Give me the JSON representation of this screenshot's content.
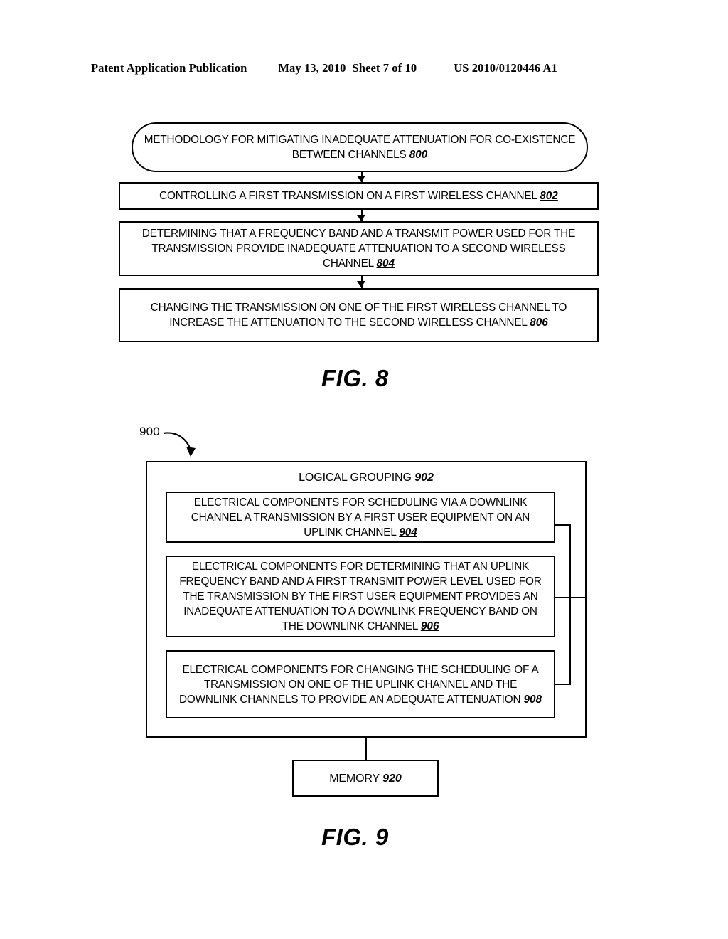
{
  "header": {
    "publication": "Patent Application Publication",
    "date": "May 13, 2010",
    "sheet": "Sheet 7 of 10",
    "doc_number": "US 2010/0120446 A1"
  },
  "figure8": {
    "caption": "FIG. 8",
    "nodes": [
      {
        "id": "800",
        "shape": "rounded",
        "text": "METHODOLOGY FOR MITIGATING INADEQUATE ATTENUATION FOR CO-EXISTENCE BETWEEN CHANNELS ",
        "ref": "800"
      },
      {
        "id": "802",
        "shape": "rect",
        "text": "CONTROLLING A FIRST TRANSMISSION ON A FIRST WIRELESS CHANNEL ",
        "ref": "802"
      },
      {
        "id": "804",
        "shape": "rect",
        "text": "DETERMINING THAT A FREQUENCY BAND AND A TRANSMIT POWER USED FOR THE TRANSMISSION PROVIDE INADEQUATE ATTENUATION TO A SECOND WIRELESS CHANNEL ",
        "ref": "804"
      },
      {
        "id": "806",
        "shape": "rect",
        "text": "CHANGING THE TRANSMISSION ON ONE OF THE FIRST WIRELESS CHANNEL TO INCREASE THE ATTENUATION TO THE SECOND WIRELESS CHANNEL ",
        "ref": "806"
      }
    ]
  },
  "figure9": {
    "caption": "FIG. 9",
    "system_ref": "900",
    "group_label": "LOGICAL GROUPING ",
    "group_ref": "902",
    "components": [
      {
        "id": "904",
        "text": "ELECTRICAL COMPONENTS FOR SCHEDULING VIA A DOWNLINK CHANNEL A TRANSMISSION BY A FIRST USER EQUIPMENT ON AN UPLINK CHANNEL ",
        "ref": "904"
      },
      {
        "id": "906",
        "text": "ELECTRICAL COMPONENTS FOR DETERMINING THAT AN UPLINK FREQUENCY BAND AND A FIRST TRANSMIT POWER LEVEL USED FOR THE TRANSMISSION BY THE FIRST USER EQUIPMENT PROVIDES AN INADEQUATE ATTENUATION TO A DOWNLINK FREQUENCY BAND ON THE DOWNLINK CHANNEL ",
        "ref": "906"
      },
      {
        "id": "908",
        "text": "ELECTRICAL COMPONENTS FOR CHANGING THE SCHEDULING OF A TRANSMISSION ON ONE OF THE UPLINK CHANNEL AND THE DOWNLINK CHANNELS TO PROVIDE AN ADEQUATE ATTENUATION ",
        "ref": "908"
      }
    ],
    "memory": {
      "text": "MEMORY ",
      "ref": "920"
    }
  }
}
